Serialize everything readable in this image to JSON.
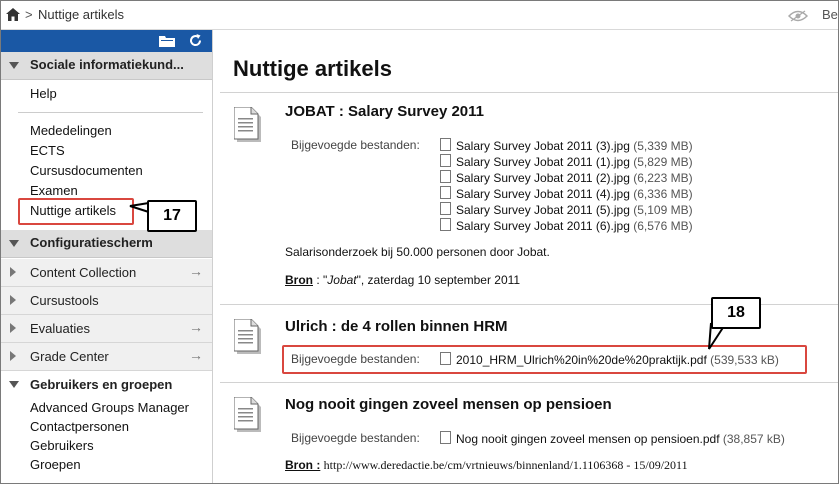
{
  "breadcrumb": {
    "separator": ">",
    "current": "Nuttige artikels"
  },
  "topbar": {
    "right_text": "Be"
  },
  "sidebar": {
    "course_title": "Sociale informatiekund...",
    "help": "Help",
    "course_links": [
      "Mededelingen",
      "ECTS",
      "Cursusdocumenten",
      "Examen",
      "Nuttige artikels"
    ],
    "config_title": "Configuratiescherm",
    "config_rows": [
      "Content Collection",
      "Cursustools",
      "Evaluaties",
      "Grade Center"
    ],
    "arrow_glyph": "→",
    "users_title": "Gebruikers en groepen",
    "user_links": [
      "Advanced Groups Manager",
      "Contactpersonen",
      "Gebruikers",
      "Groepen"
    ]
  },
  "main": {
    "title": "Nuttige artikels",
    "items": [
      {
        "title": "JOBAT : Salary Survey 2011",
        "attach_label": "Bijgevoegde bestanden:",
        "files": [
          {
            "name": "Salary Survey Jobat 2011 (3).jpg",
            "size": "(5,339 MB)"
          },
          {
            "name": "Salary Survey Jobat 2011 (1).jpg",
            "size": "(5,829 MB)"
          },
          {
            "name": "Salary Survey Jobat 2011 (2).jpg",
            "size": "(6,223 MB)"
          },
          {
            "name": "Salary Survey Jobat 2011 (4).jpg",
            "size": "(6,336 MB)"
          },
          {
            "name": "Salary Survey Jobat 2011 (5).jpg",
            "size": "(5,109 MB)"
          },
          {
            "name": "Salary Survey Jobat 2011 (6).jpg",
            "size": "(6,576 MB)"
          }
        ],
        "description": "Salarisonderzoek bij 50.000 personen door Jobat.",
        "source_label": "Bron",
        "source_sep": " : \"",
        "source_name": "Jobat",
        "source_date": "\", zaterdag 10 september 2011"
      },
      {
        "title": "Ulrich : de 4 rollen binnen HRM",
        "attach_label": "Bijgevoegde bestanden:",
        "files": [
          {
            "name": "2010_HRM_Ulrich%20in%20de%20praktijk.pdf",
            "size": "(539,533 kB)"
          }
        ]
      },
      {
        "title": "Nog nooit gingen zoveel mensen op pensioen",
        "attach_label": "Bijgevoegde bestanden:",
        "files": [
          {
            "name": "Nog nooit gingen zoveel mensen op pensioen.pdf",
            "size": "(38,857 kB)"
          }
        ],
        "source_label": "Bron :",
        "source_url": "http://www.deredactie.be/cm/vrtnieuws/binnenland/1.1106368 - 15/09/2011"
      }
    ]
  },
  "callouts": {
    "first": "17",
    "second": "18"
  },
  "colors": {
    "sidebar_toolbar": "#1a58a5",
    "highlight": "#d9473f",
    "section_head": "#dedede"
  }
}
